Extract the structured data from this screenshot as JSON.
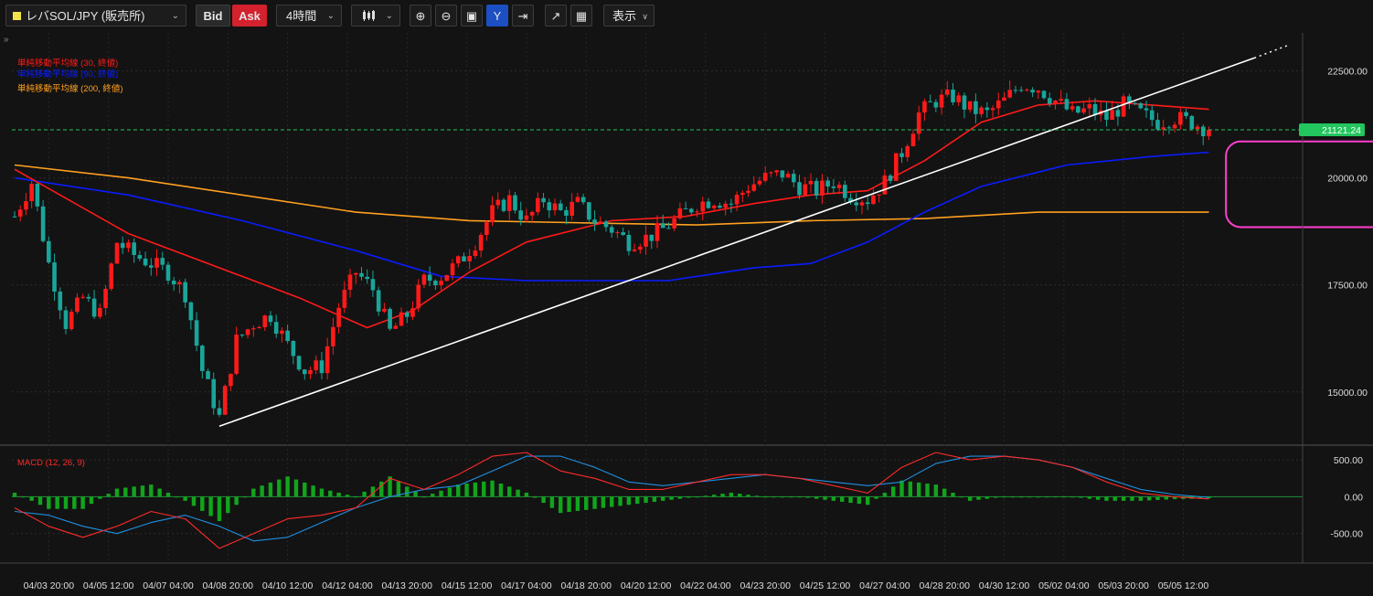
{
  "toolbar": {
    "symbol": "レバSOL/JPY (販売所)",
    "bid_label": "Bid",
    "ask_label": "Ask",
    "timeframe": "4時間",
    "chart_type_icon": "candlestick-icon",
    "icons": [
      "zoom-in-icon",
      "zoom-out-icon",
      "fit-icon",
      "y-axis-lock-icon",
      "scroll-to-end-icon",
      "add-indicator-icon",
      "screenshot-icon"
    ],
    "view_label": "表示",
    "collapse_symbol": "»"
  },
  "colors": {
    "up": "#ff1a1a",
    "down": "#1aa59a",
    "sma30": "#ff1a1a",
    "sma90": "#0a1cff",
    "sma200": "#ffa020",
    "price_line": "#22c55e",
    "trendline": "#ffffff",
    "highlight": "#ff3ed0",
    "macd": "#ff2a2a",
    "signal": "#1f8fe0",
    "hist": "#11a51c"
  },
  "chart_data": {
    "type": "candlestick",
    "x_ticks": [
      "04/03 20:00",
      "04/05 12:00",
      "04/07 04:00",
      "04/08 20:00",
      "04/10 12:00",
      "04/12 04:00",
      "04/13 20:00",
      "04/15 12:00",
      "04/17 04:00",
      "04/18 20:00",
      "04/20 12:00",
      "04/22 04:00",
      "04/23 20:00",
      "04/25 12:00",
      "04/27 04:00",
      "04/28 20:00",
      "04/30 12:00",
      "05/02 04:00",
      "05/03 20:00",
      "05/05 12:00"
    ],
    "y_ticks": [
      "22500.00",
      "20000.00",
      "17500.00",
      "15000.00"
    ],
    "y_range": [
      13800,
      23300
    ],
    "current_price": "21121.24",
    "legend": [
      {
        "label": "単純移動平均線 (30, 終値)",
        "color": "#ff1a1a"
      },
      {
        "label": "単純移動平均線 (90, 終値)",
        "color": "#0a1cff"
      },
      {
        "label": "単純移動平均線 (200, 終値)",
        "color": "#ffa020"
      }
    ],
    "key_closes": [
      [
        0,
        19100
      ],
      [
        3,
        19900
      ],
      [
        6,
        18000
      ],
      [
        9,
        16600
      ],
      [
        12,
        17200
      ],
      [
        15,
        16800
      ],
      [
        18,
        18500
      ],
      [
        21,
        18200
      ],
      [
        24,
        18000
      ],
      [
        27,
        17800
      ],
      [
        30,
        17300
      ],
      [
        33,
        15500
      ],
      [
        36,
        14400
      ],
      [
        39,
        16200
      ],
      [
        42,
        16600
      ],
      [
        45,
        16800
      ],
      [
        48,
        16100
      ],
      [
        51,
        15500
      ],
      [
        54,
        15600
      ],
      [
        57,
        17000
      ],
      [
        60,
        17800
      ],
      [
        63,
        17400
      ],
      [
        66,
        16400
      ],
      [
        69,
        16800
      ],
      [
        72,
        17600
      ],
      [
        75,
        17700
      ],
      [
        78,
        18000
      ],
      [
        81,
        18500
      ],
      [
        84,
        19200
      ],
      [
        87,
        19500
      ],
      [
        90,
        19000
      ],
      [
        93,
        19500
      ],
      [
        96,
        19200
      ],
      [
        99,
        19400
      ],
      [
        102,
        19000
      ],
      [
        105,
        18800
      ],
      [
        108,
        18500
      ],
      [
        111,
        18600
      ],
      [
        114,
        18800
      ],
      [
        117,
        19100
      ],
      [
        120,
        19400
      ],
      [
        123,
        19500
      ],
      [
        126,
        19400
      ],
      [
        129,
        19800
      ],
      [
        132,
        20000
      ],
      [
        135,
        20100
      ],
      [
        138,
        19800
      ],
      [
        141,
        19700
      ],
      [
        144,
        19900
      ],
      [
        147,
        19600
      ],
      [
        150,
        19500
      ],
      [
        153,
        19900
      ],
      [
        156,
        20600
      ],
      [
        159,
        21500
      ],
      [
        162,
        21800
      ],
      [
        165,
        21900
      ],
      [
        168,
        21600
      ],
      [
        171,
        21500
      ],
      [
        174,
        21800
      ],
      [
        177,
        22200
      ],
      [
        180,
        22100
      ],
      [
        183,
        21800
      ],
      [
        186,
        21500
      ],
      [
        189,
        21600
      ],
      [
        192,
        21400
      ],
      [
        195,
        21700
      ],
      [
        198,
        21500
      ],
      [
        201,
        21300
      ],
      [
        204,
        21400
      ],
      [
        207,
        21300
      ],
      [
        210,
        21121
      ]
    ],
    "sma_lines": {
      "sma30": [
        [
          0,
          20200
        ],
        [
          20,
          18700
        ],
        [
          40,
          17700
        ],
        [
          50,
          17200
        ],
        [
          62,
          16500
        ],
        [
          70,
          16900
        ],
        [
          80,
          17800
        ],
        [
          90,
          18500
        ],
        [
          105,
          19000
        ],
        [
          118,
          19100
        ],
        [
          130,
          19400
        ],
        [
          140,
          19600
        ],
        [
          150,
          19700
        ],
        [
          160,
          20400
        ],
        [
          170,
          21300
        ],
        [
          180,
          21700
        ],
        [
          190,
          21800
        ],
        [
          200,
          21700
        ],
        [
          210,
          21600
        ]
      ],
      "sma90": [
        [
          0,
          20000
        ],
        [
          20,
          19600
        ],
        [
          40,
          19000
        ],
        [
          60,
          18300
        ],
        [
          75,
          17700
        ],
        [
          90,
          17600
        ],
        [
          100,
          17600
        ],
        [
          115,
          17600
        ],
        [
          130,
          17900
        ],
        [
          140,
          18000
        ],
        [
          150,
          18500
        ],
        [
          160,
          19200
        ],
        [
          170,
          19800
        ],
        [
          185,
          20300
        ],
        [
          200,
          20500
        ],
        [
          210,
          20600
        ]
      ],
      "sma200": [
        [
          0,
          20300
        ],
        [
          20,
          20000
        ],
        [
          40,
          19600
        ],
        [
          60,
          19200
        ],
        [
          80,
          19000
        ],
        [
          100,
          18950
        ],
        [
          120,
          18900
        ],
        [
          140,
          19000
        ],
        [
          160,
          19050
        ],
        [
          180,
          19200
        ],
        [
          200,
          19200
        ],
        [
          210,
          19200
        ]
      ]
    },
    "trendline": {
      "from": [
        36,
        14200
      ],
      "to": [
        218,
        22800
      ],
      "dotted_to": [
        224,
        23100
      ]
    },
    "macd": {
      "label": "MACD (12, 26, 9)",
      "y_ticks": [
        "500.00",
        "0.00",
        "-500.00"
      ],
      "range": [
        -900,
        650
      ],
      "macd": [
        [
          0,
          -150
        ],
        [
          6,
          -400
        ],
        [
          12,
          -550
        ],
        [
          18,
          -400
        ],
        [
          24,
          -200
        ],
        [
          30,
          -300
        ],
        [
          36,
          -700
        ],
        [
          42,
          -500
        ],
        [
          48,
          -300
        ],
        [
          54,
          -250
        ],
        [
          60,
          -150
        ],
        [
          66,
          250
        ],
        [
          72,
          100
        ],
        [
          78,
          300
        ],
        [
          84,
          550
        ],
        [
          90,
          600
        ],
        [
          96,
          350
        ],
        [
          102,
          250
        ],
        [
          108,
          100
        ],
        [
          114,
          100
        ],
        [
          120,
          200
        ],
        [
          126,
          300
        ],
        [
          132,
          300
        ],
        [
          138,
          250
        ],
        [
          144,
          150
        ],
        [
          150,
          50
        ],
        [
          156,
          400
        ],
        [
          162,
          600
        ],
        [
          168,
          500
        ],
        [
          174,
          550
        ],
        [
          180,
          500
        ],
        [
          186,
          400
        ],
        [
          192,
          200
        ],
        [
          198,
          50
        ],
        [
          204,
          0
        ],
        [
          210,
          -30
        ]
      ],
      "signal": [
        [
          0,
          -200
        ],
        [
          6,
          -250
        ],
        [
          12,
          -400
        ],
        [
          18,
          -500
        ],
        [
          24,
          -350
        ],
        [
          30,
          -250
        ],
        [
          36,
          -400
        ],
        [
          42,
          -600
        ],
        [
          48,
          -550
        ],
        [
          54,
          -350
        ],
        [
          60,
          -150
        ],
        [
          66,
          0
        ],
        [
          72,
          100
        ],
        [
          78,
          150
        ],
        [
          84,
          350
        ],
        [
          90,
          550
        ],
        [
          96,
          550
        ],
        [
          102,
          400
        ],
        [
          108,
          200
        ],
        [
          114,
          150
        ],
        [
          120,
          200
        ],
        [
          126,
          250
        ],
        [
          132,
          300
        ],
        [
          138,
          250
        ],
        [
          144,
          200
        ],
        [
          150,
          150
        ],
        [
          156,
          200
        ],
        [
          162,
          450
        ],
        [
          168,
          550
        ],
        [
          174,
          550
        ],
        [
          180,
          500
        ],
        [
          186,
          400
        ],
        [
          192,
          250
        ],
        [
          198,
          100
        ],
        [
          204,
          30
        ],
        [
          210,
          -10
        ]
      ]
    }
  }
}
